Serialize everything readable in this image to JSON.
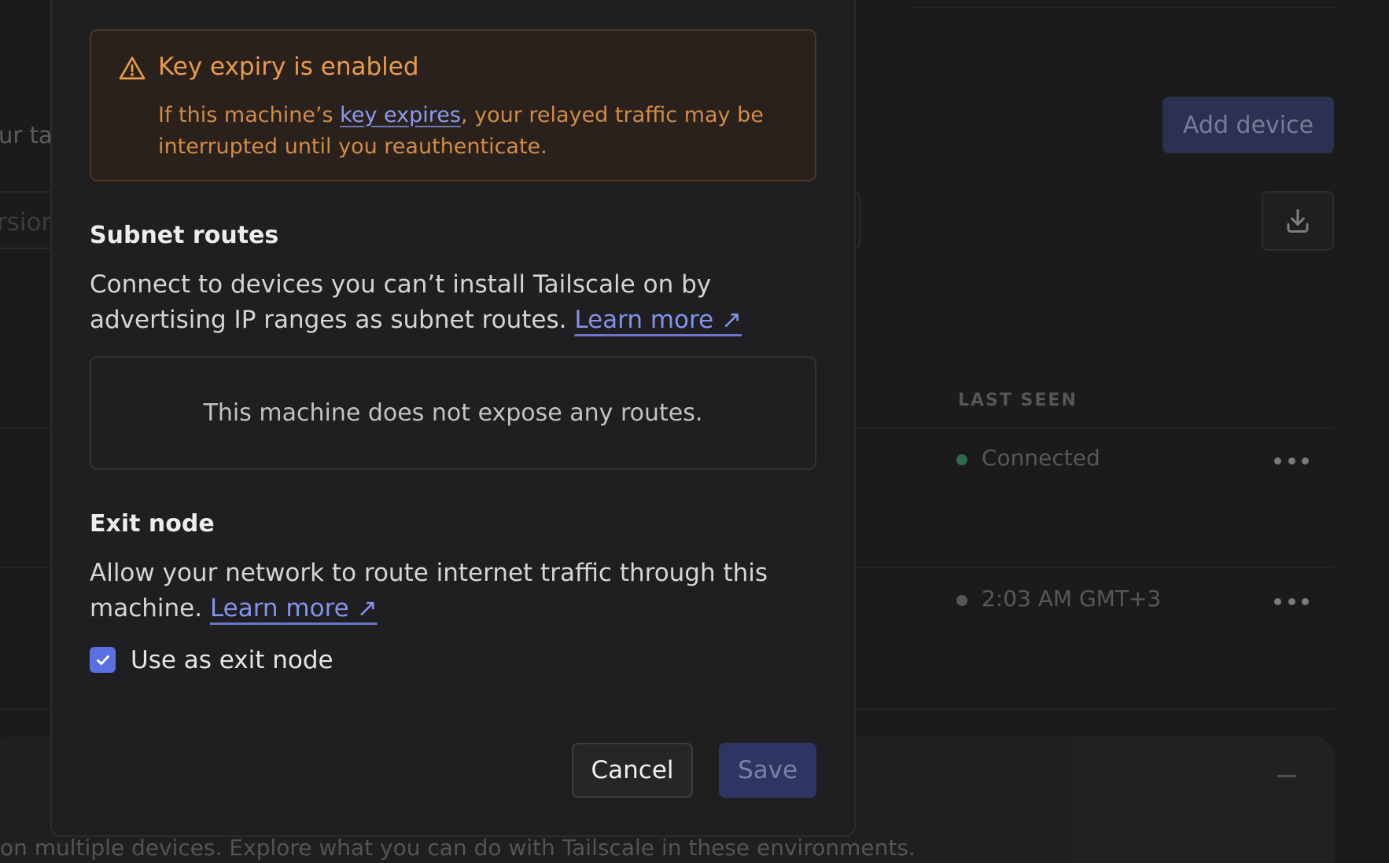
{
  "background": {
    "partial_heading": "ur tai",
    "partial_search_placeholder": "rsion",
    "add_device_label": "Add device",
    "download_icon": "download-icon",
    "table": {
      "last_seen_header": "LAST SEEN",
      "rows": [
        {
          "status": "Connected",
          "status_color": "#2f6a4d"
        },
        {
          "status": "2:03 AM GMT+3",
          "status_color": "#55575a"
        }
      ]
    },
    "footer_text": "on multiple devices. Explore what you can do with Tailscale in these environments."
  },
  "modal": {
    "alert": {
      "icon": "warning-icon",
      "title": "Key expiry is enabled",
      "body_before": "If this machine’s ",
      "body_link": "key expires",
      "body_after": ", your relayed traffic may be interrupted until you reauthenticate."
    },
    "subnet_routes": {
      "title": "Subnet routes",
      "description": "Connect to devices you can’t install Tailscale on by advertising IP ranges as subnet routes.",
      "learn_more": "Learn more ↗",
      "empty_message": "This machine does not expose any routes."
    },
    "exit_node": {
      "title": "Exit node",
      "description": "Allow your network to route internet traffic through this machine.",
      "learn_more": "Learn more ↗",
      "checkbox_label": "Use as exit node",
      "checked": true
    },
    "actions": {
      "cancel": "Cancel",
      "save": "Save"
    }
  },
  "colors": {
    "accent": "#5b6fe3",
    "warning": "#e99a4a",
    "link": "#8c9bef"
  }
}
